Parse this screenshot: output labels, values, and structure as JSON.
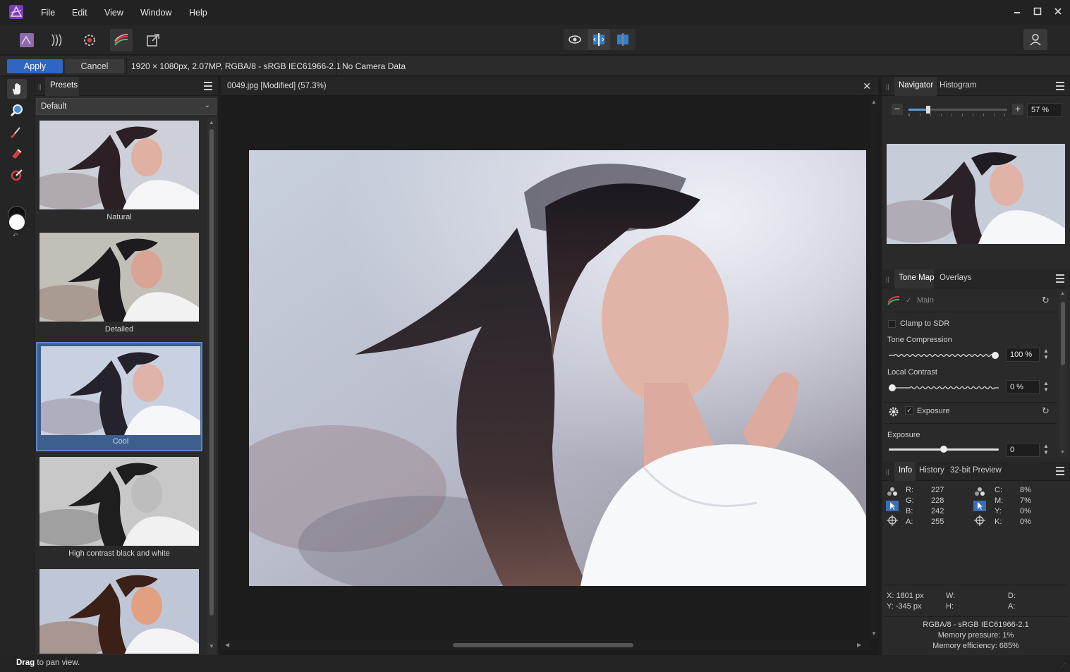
{
  "menu": {
    "items": [
      "File",
      "Edit",
      "View",
      "Window",
      "Help"
    ]
  },
  "context": {
    "apply_label": "Apply",
    "cancel_label": "Cancel",
    "doc_info": "1920 × 1080px, 2.07MP, RGBA/8 - sRGB IEC61966-2.1",
    "camera": "No Camera Data"
  },
  "presets_panel": {
    "tab": "Presets",
    "selected_preset": "Default",
    "items": [
      {
        "label": "Natural",
        "style": "natural"
      },
      {
        "label": "Detailed",
        "style": "detailed"
      },
      {
        "label": "Cool",
        "style": "cool",
        "selected": true
      },
      {
        "label": "High contrast black and white",
        "style": "bw"
      },
      {
        "label": "",
        "style": "warm"
      }
    ]
  },
  "document": {
    "title": "0049.jpg [Modified] (57.3%)"
  },
  "navigator": {
    "tabs": [
      "Navigator",
      "Histogram"
    ],
    "zoom": "57 %",
    "zoom_fraction": 0.2
  },
  "tonemap": {
    "tabs": [
      "Tone Map",
      "Overlays"
    ],
    "main_label": "Main",
    "clamp_label": "Clamp to SDR",
    "tone_compression_label": "Tone Compression",
    "tone_compression_value": "100 %",
    "tone_compression_fraction": 1.0,
    "local_contrast_label": "Local Contrast",
    "local_contrast_value": "0 %",
    "local_contrast_fraction": 0.0,
    "exposure_group_label": "Exposure",
    "exposure_label": "Exposure",
    "exposure_value": "0",
    "exposure_fraction": 0.5
  },
  "info": {
    "tabs": [
      "Info",
      "History",
      "32-bit Preview"
    ],
    "rgba": [
      {
        "k": "R:",
        "v": "227"
      },
      {
        "k": "G:",
        "v": "228"
      },
      {
        "k": "B:",
        "v": "242"
      },
      {
        "k": "A:",
        "v": "255"
      }
    ],
    "cmyk": [
      {
        "k": "C:",
        "v": "8%"
      },
      {
        "k": "M:",
        "v": "7%"
      },
      {
        "k": "Y:",
        "v": "0%"
      },
      {
        "k": "K:",
        "v": "0%"
      }
    ],
    "x": "X: 1801 px",
    "y": "Y: -345 px",
    "w": "W:",
    "h": "H:",
    "d": "D:",
    "a": "A:",
    "color_profile": "RGBA/8 - sRGB IEC61966-2.1",
    "memory_pressure": "Memory pressure: 1%",
    "memory_efficiency": "Memory efficiency: 685%"
  },
  "status": {
    "bold": "Drag",
    "rest": "to pan view."
  },
  "colors": {
    "accent": "#2f66c4",
    "selection": "#3e5f8e"
  }
}
